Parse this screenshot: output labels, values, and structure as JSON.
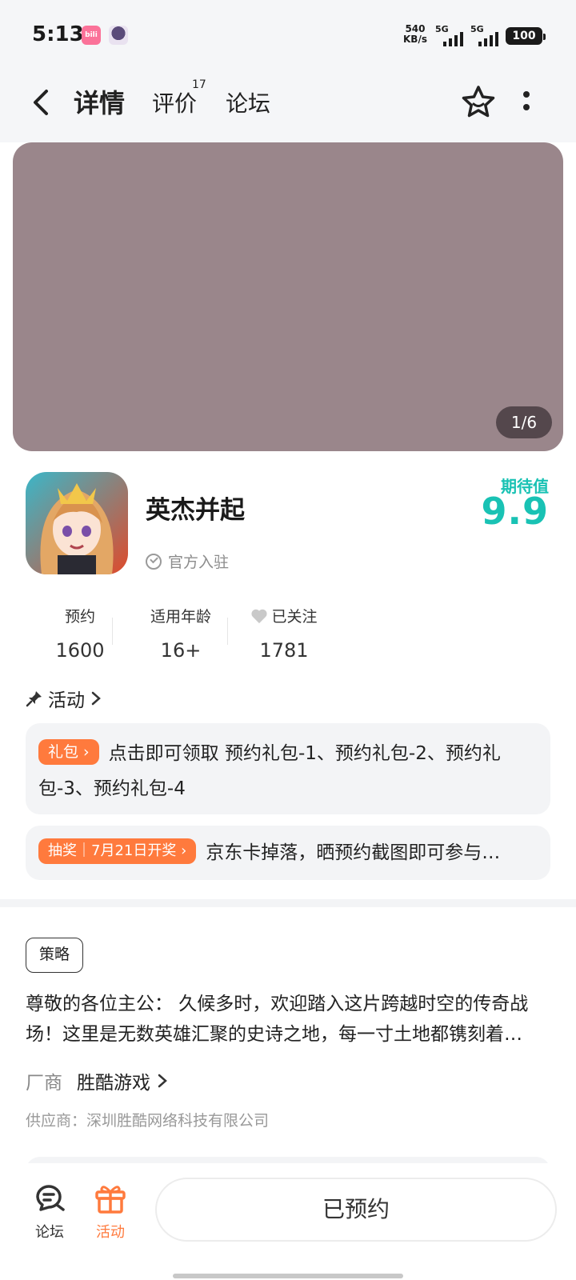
{
  "status_bar": {
    "time": "5:13",
    "net_speed_value": "540",
    "net_speed_unit": "KB/s",
    "signal_1": "5G",
    "signal_2": "5G",
    "battery": "100",
    "bili_icon_text": "bili"
  },
  "header": {
    "tabs": [
      {
        "label": "详情",
        "active": true
      },
      {
        "label": "评价",
        "badge": "17"
      },
      {
        "label": "论坛"
      }
    ]
  },
  "banner": {
    "counter": "1/6"
  },
  "game": {
    "title": "英杰并起",
    "verified_label": "官方入驻",
    "expect_label": "期待值",
    "expect_value": "9.9"
  },
  "stats": [
    {
      "label": "预约",
      "value": "1600"
    },
    {
      "label": "适用年龄",
      "value": "16+"
    },
    {
      "label": "已关注",
      "value": "1781"
    }
  ],
  "activity": {
    "header": "活动",
    "gift": {
      "pill": "礼包",
      "text": "点击即可领取 预约礼包-1、预约礼包-2、预约礼包-3、预约礼包-4"
    },
    "lottery": {
      "pill": "抽奖｜7月21日开奖",
      "text": "京东卡掉落，晒预约截图即可参与…"
    }
  },
  "strategy": {
    "badge": "策略",
    "intro": "尊敬的各位主公： 久候多时，欢迎踏入这片跨越时空的传奇战场！这里是无数英雄汇聚的史诗之地，每一寸土地都镌刻着…",
    "vendor_label": "厂商",
    "vendor_name": "胜酷游戏",
    "supplier": "供应商：深圳胜酷网络科技有限公司"
  },
  "bottom_bar": {
    "forum_label": "论坛",
    "activity_label": "活动",
    "reserve_label": "已预约"
  },
  "colors": {
    "accent": "#19c2b4",
    "orange": "#ff7a3d",
    "banner_placeholder": "#9a868b"
  }
}
